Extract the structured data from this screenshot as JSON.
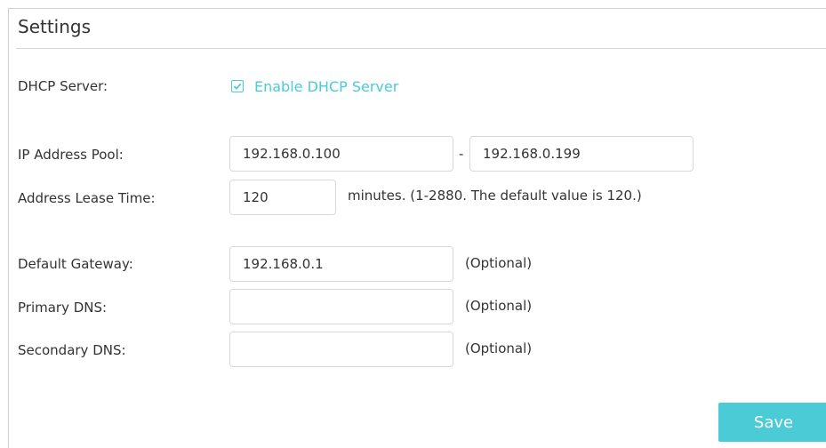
{
  "panel": {
    "title": "Settings"
  },
  "dhcp": {
    "label": "DHCP Server:",
    "enable_label": "Enable DHCP Server",
    "enabled": true
  },
  "ip_pool": {
    "label": "IP Address Pool:",
    "start": "192.168.0.100",
    "separator": "-",
    "end": "192.168.0.199"
  },
  "lease": {
    "label": "Address Lease Time:",
    "value": "120",
    "note": "minutes. (1-2880. The default value is 120.)"
  },
  "gateway": {
    "label": "Default Gateway:",
    "value": "192.168.0.1",
    "note": "(Optional)"
  },
  "primary_dns": {
    "label": "Primary DNS:",
    "value": "",
    "note": "(Optional)"
  },
  "secondary_dns": {
    "label": "Secondary DNS:",
    "value": "",
    "note": "(Optional)"
  },
  "actions": {
    "save_label": "Save"
  },
  "colors": {
    "accent": "#4acbd6",
    "text": "#333333",
    "border": "#d9d9d9"
  }
}
